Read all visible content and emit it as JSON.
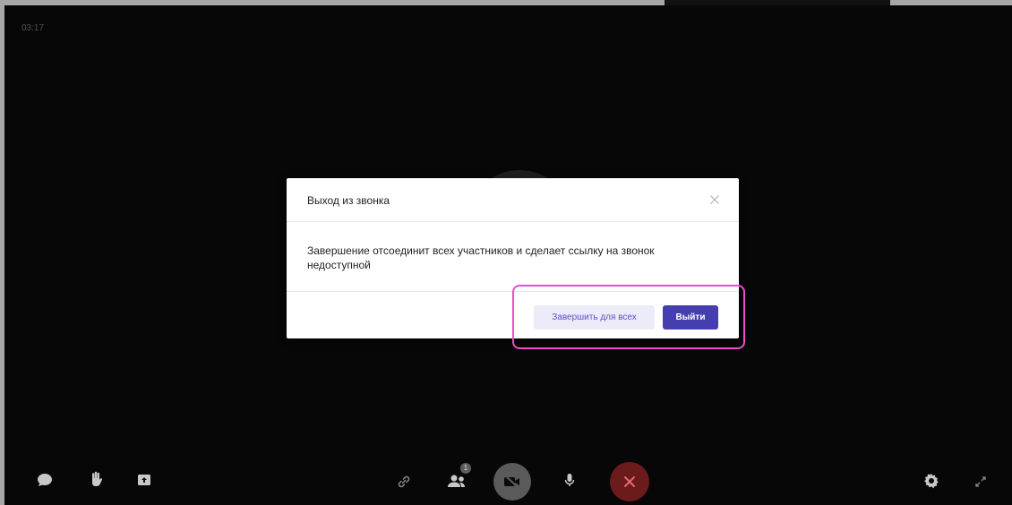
{
  "call": {
    "timer": "03:17"
  },
  "modal": {
    "title": "Выход из звонка",
    "body": "Завершение отсоединит всех участников и сделает ссылку на звонок недоступной",
    "end_for_all_label": "Завершить для всех",
    "exit_label": "Выйти"
  },
  "toolbar": {
    "participants_count": "1",
    "icons": [
      "chat-icon",
      "raise-hand-icon",
      "share-screen-icon",
      "link-icon",
      "participants-icon",
      "camera-off-icon",
      "microphone-icon",
      "hang-up-icon",
      "settings-icon",
      "fullscreen-icon"
    ]
  },
  "colors": {
    "background": "#0b0b0b",
    "primary_button": "#443eaf",
    "secondary_button_bg": "#ecebf8",
    "hangup": "#6b1b1b",
    "highlight": "#f04ad0"
  }
}
